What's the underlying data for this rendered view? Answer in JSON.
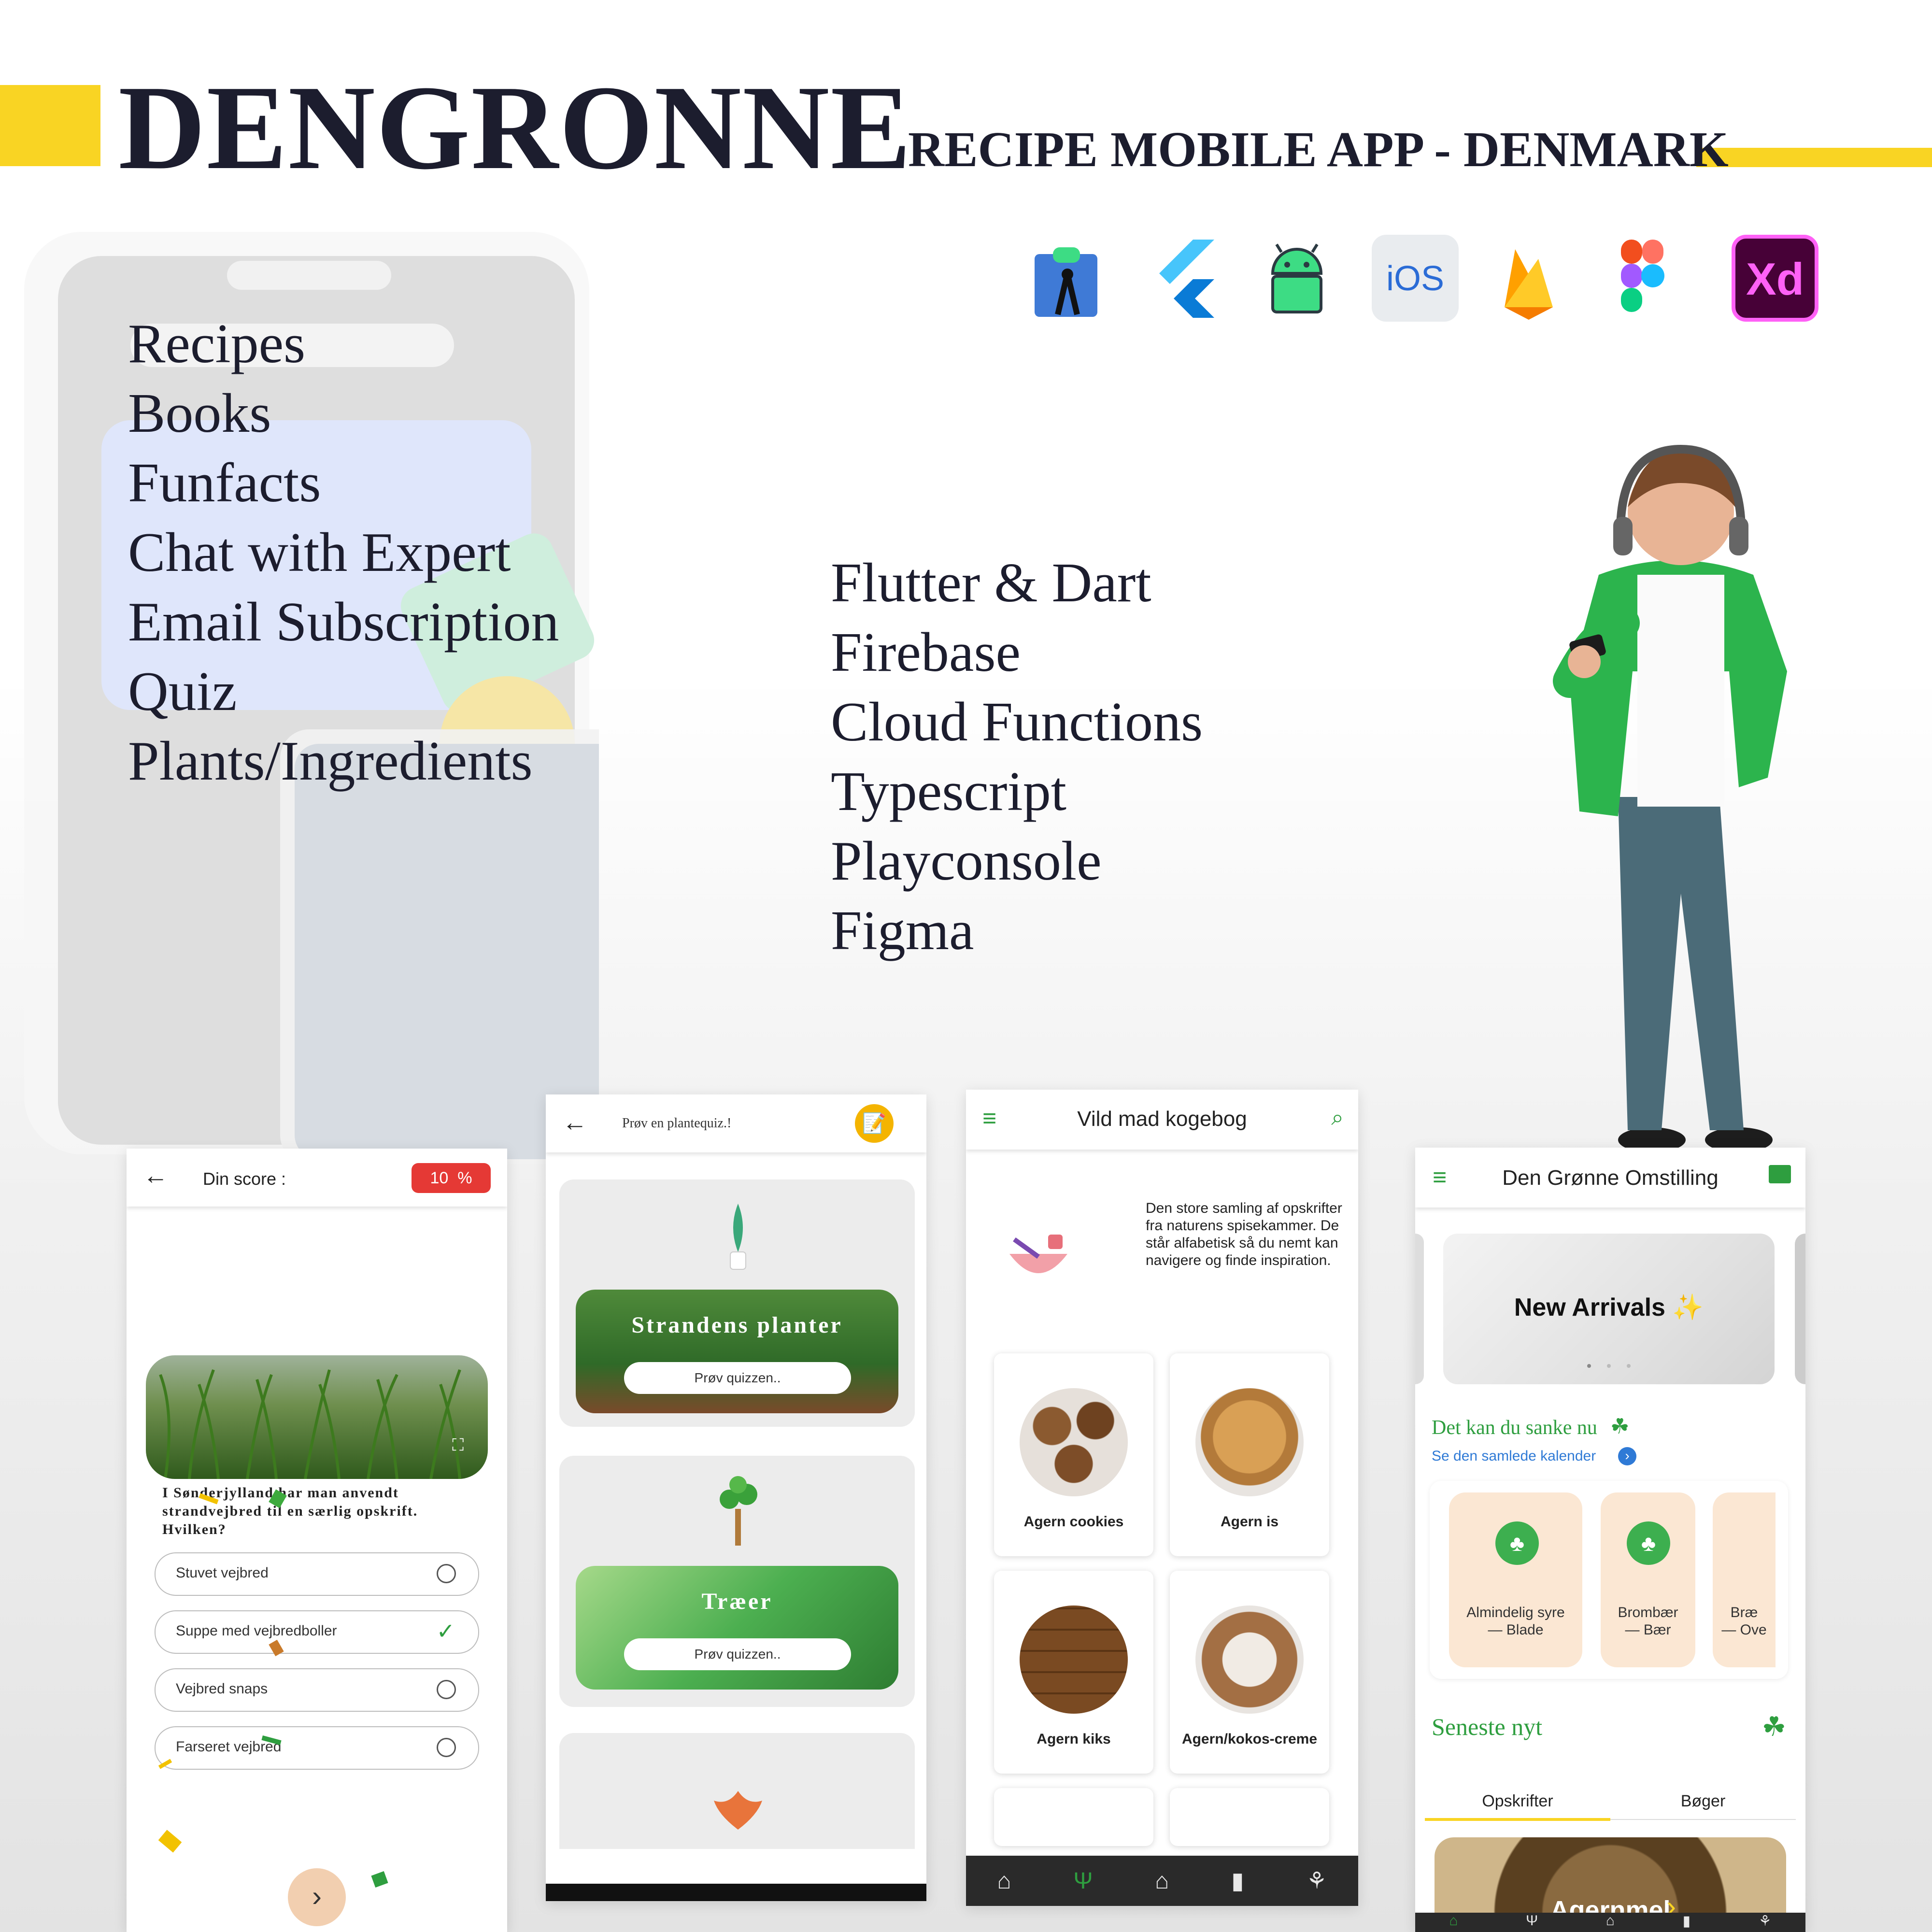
{
  "header": {
    "brand": "DENGRONNE",
    "subtitle": "RECIPE MOBILE APP - DENMARK"
  },
  "tech_icons": [
    "android-studio-icon",
    "flutter-icon",
    "android-icon",
    "ios-icon",
    "firebase-icon",
    "figma-icon",
    "adobe-xd-icon"
  ],
  "tech_icon_texts": {
    "ios": "iOS",
    "xd": "Xd"
  },
  "features": [
    "Recipes",
    "Books",
    "Funfacts",
    "Chat with Expert",
    "Email Subscription",
    "Quiz",
    "Plants/Ingredients"
  ],
  "technologies": [
    "Flutter & Dart",
    "Firebase",
    "Cloud Functions",
    "Typescript",
    "Playconsole",
    "Figma"
  ],
  "quiz_screen": {
    "score_label": "Din score :",
    "score_badge": "10  %",
    "question": "I Sønderjylland har man anvendt strandvejbred til en særlig opskrift. Hvilken?",
    "options": [
      {
        "label": "Stuvet vejbred",
        "selected": false
      },
      {
        "label": "Suppe med vejbredboller",
        "selected": true
      },
      {
        "label": "Vejbred snaps",
        "selected": false
      },
      {
        "label": "Farseret vejbred",
        "selected": false
      }
    ],
    "next_icon": "chevron-right-icon"
  },
  "plantquiz_screen": {
    "title": "Prøv en plantequiz.!",
    "cards": [
      {
        "title": "Strandens planter",
        "button": "Prøv quizzen.."
      },
      {
        "title": "Træer",
        "button": "Prøv quizzen.."
      }
    ]
  },
  "cookbook_screen": {
    "title": "Vild mad kogebog",
    "intro": "Den store samling af opskrifter fra naturens spisekammer. De står alfabetisk så du nemt kan navigere og finde inspiration.",
    "recipes": [
      "Agern cookies",
      "Agern is",
      "Agern kiks",
      "Agern/kokos-creme"
    ]
  },
  "home_screen": {
    "title": "Den Grønne Omstilling",
    "carousel_title": "New Arrivals ✨",
    "section_title": "Det kan du sanke nu",
    "calendar_link": "Se den samlede kalender",
    "season_items": [
      {
        "name": "Almindelig syre",
        "part": "— Blade"
      },
      {
        "name": "Brombær",
        "part": "— Bær"
      },
      {
        "name": "Bræ",
        "part": "— Ove"
      }
    ],
    "news_title": "Seneste nyt",
    "tabs": [
      "Opskrifter",
      "Bøger"
    ],
    "featured": "Agernmel"
  },
  "colors": {
    "accent_yellow": "#f9d423",
    "brand_green": "#2e9e3f",
    "score_red": "#e53935",
    "dark_text": "#1c1d2e"
  }
}
